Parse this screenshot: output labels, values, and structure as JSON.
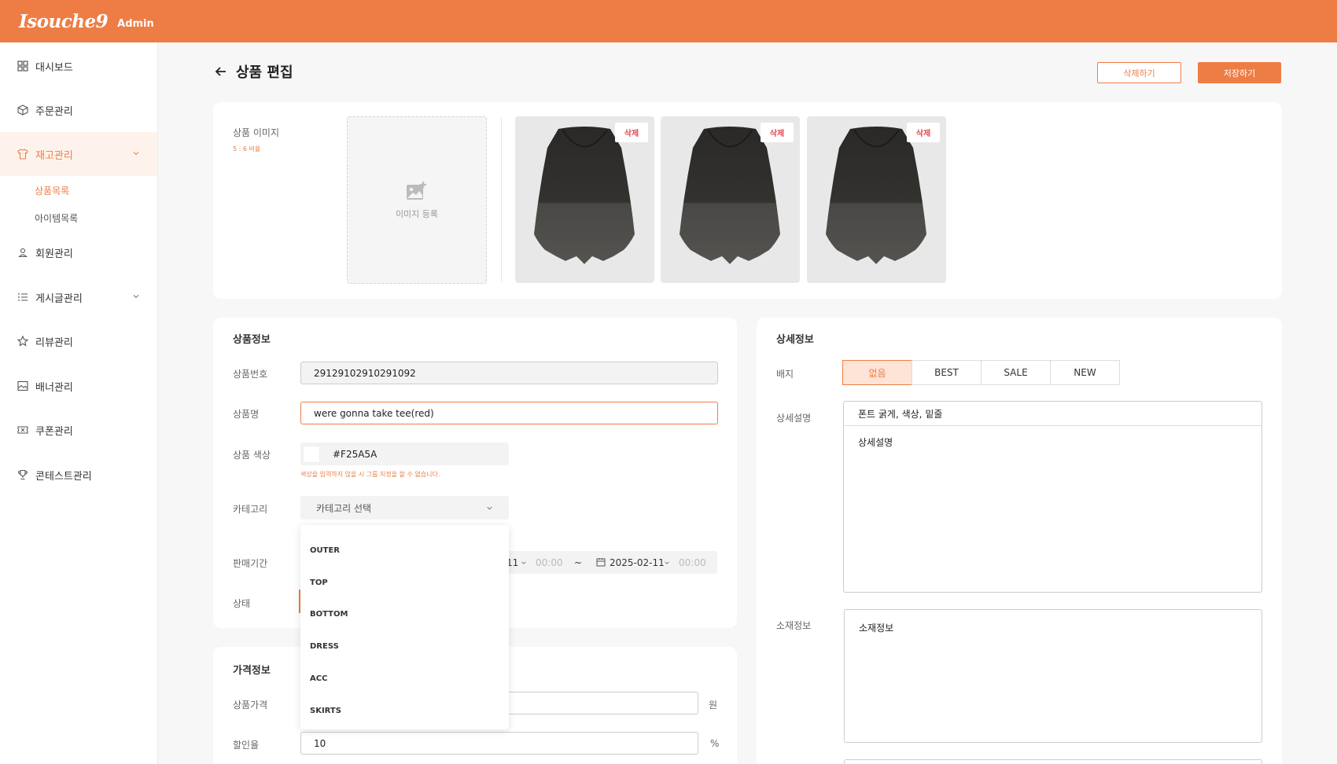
{
  "brand": {
    "logo": "Isouche9",
    "sub": "Admin"
  },
  "sidebar": {
    "items": [
      {
        "label": "대시보드",
        "icon": "grid-icon"
      },
      {
        "label": "주문관리",
        "icon": "box-icon"
      },
      {
        "label": "재고관리",
        "icon": "shirt-icon",
        "active": true,
        "expanded": true
      },
      {
        "label": "회원관리",
        "icon": "user-icon"
      },
      {
        "label": "게시글관리",
        "icon": "list-icon",
        "expandable": true
      },
      {
        "label": "리뷰관리",
        "icon": "star-icon"
      },
      {
        "label": "배너관리",
        "icon": "image-icon"
      },
      {
        "label": "쿠폰관리",
        "icon": "ticket-icon"
      },
      {
        "label": "콘테스트관리",
        "icon": "trophy-icon"
      }
    ],
    "subitems": [
      {
        "label": "상품목록",
        "active": true
      },
      {
        "label": "아이템목록"
      }
    ]
  },
  "header": {
    "title": "상품 편집",
    "delete_label": "삭제하기",
    "save_label": "저장하기"
  },
  "images": {
    "label": "상품 이미지",
    "ratio_hint": "5 : 6 비율",
    "upload_label": "이미지 등록",
    "delete_label": "삭제",
    "count": 3
  },
  "product_info": {
    "title": "상품정보",
    "number_label": "상품번호",
    "number_value": "29129102910291092",
    "name_label": "상품명",
    "name_value": "were gonna take tee(red)",
    "color_label": "상품 색상",
    "color_value": "#F25A5A",
    "color_hint": "색상을 입력하지 않을 시 그룹 지정을 할 수 없습니다.",
    "category_label": "카테고리",
    "category_placeholder": "카테고리 선택",
    "category_options": [
      "OUTER",
      "TOP",
      "BOTTOM",
      "DRESS",
      "ACC",
      "SKIRTS"
    ],
    "period_label": "판매기간",
    "period_start_date_partial": "11",
    "period_start_time": "00:00",
    "period_sep": "~",
    "period_end_date": "2025-02-11",
    "period_end_time": "00:00",
    "status_label": "상태"
  },
  "price_info": {
    "title": "가격정보",
    "price_label": "상품가격",
    "price_unit": "원",
    "discount_label": "할인율",
    "discount_value": "10",
    "discount_unit": "%"
  },
  "detail_info": {
    "title": "상세정보",
    "badge_label": "배지",
    "badges": [
      "없음",
      "BEST",
      "SALE",
      "NEW"
    ],
    "active_badge": "없음",
    "desc_label": "상세설명",
    "desc_toolbar": "폰트 굵게, 색상, 밑줄",
    "desc_body": "상세설명",
    "material_label": "소재정보",
    "material_body": "소재정보"
  },
  "colors": {
    "accent": "#ee7d45",
    "delete_red": "#e5484d"
  }
}
